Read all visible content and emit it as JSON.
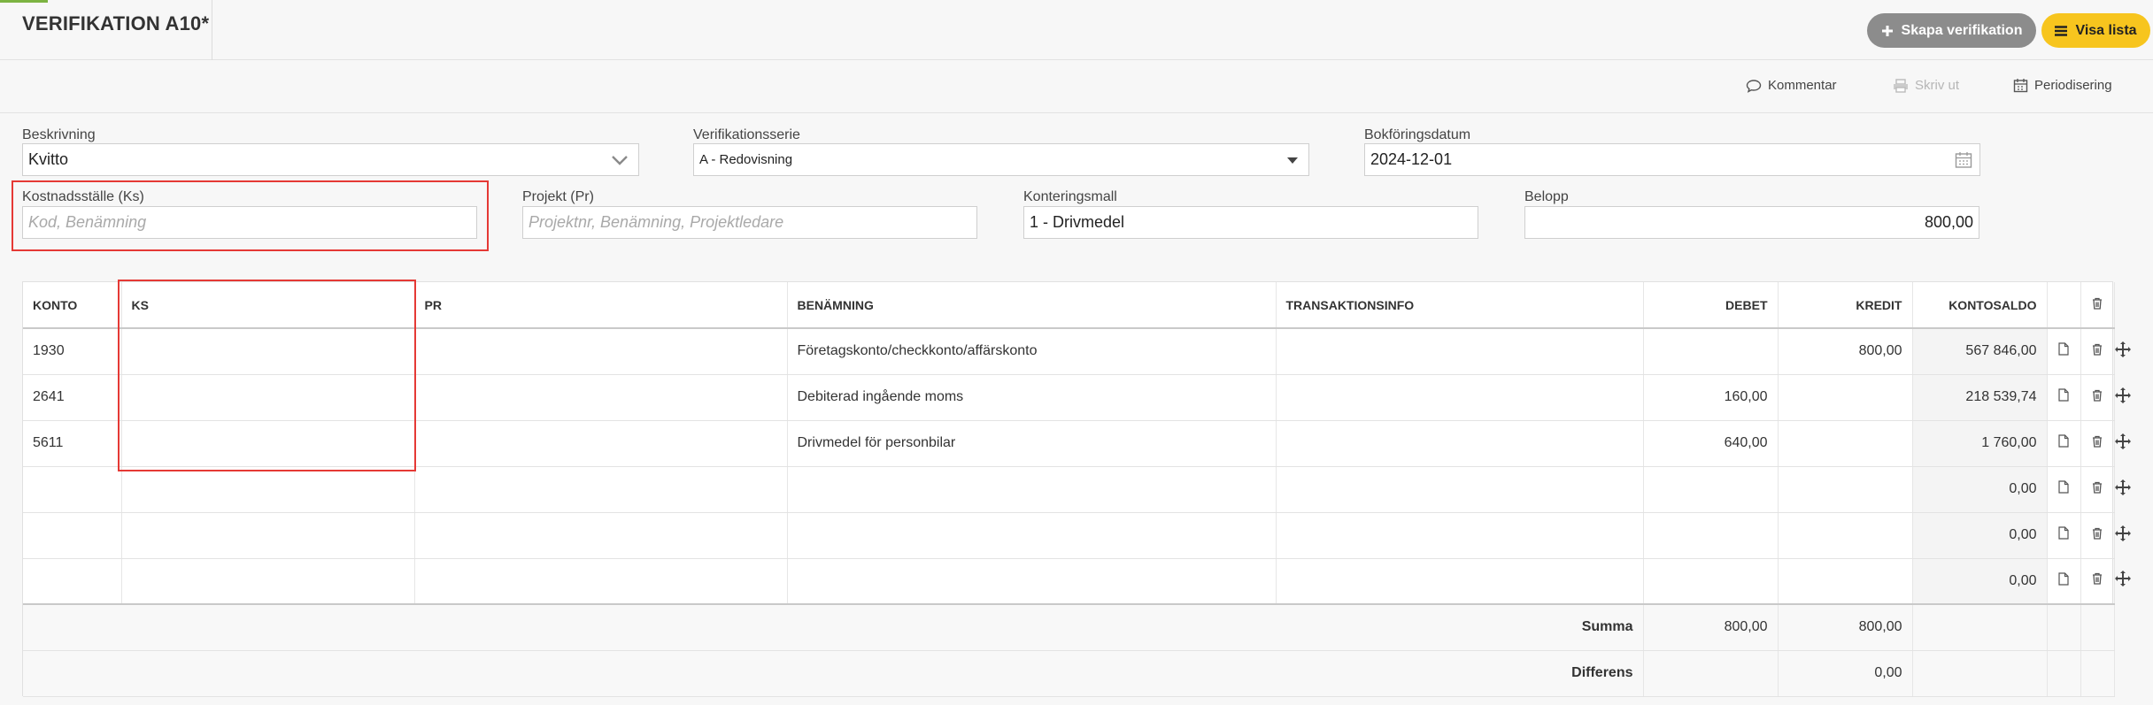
{
  "header": {
    "title": "VERIFIKATION A10*",
    "create_button": "Skapa verifikation",
    "list_button": "Visa lista"
  },
  "actions": {
    "comment": "Kommentar",
    "print": "Skriv ut",
    "accrual": "Periodisering"
  },
  "form": {
    "beskrivning_label": "Beskrivning",
    "beskrivning_value": "Kvitto",
    "serie_label": "Verifikationsserie",
    "serie_value": "A - Redovisning",
    "datum_label": "Bokföringsdatum",
    "datum_value": "2024-12-01",
    "ks_label": "Kostnadsställe (Ks)",
    "ks_placeholder": "Kod, Benämning",
    "projekt_label": "Projekt (Pr)",
    "projekt_placeholder": "Projektnr, Benämning, Projektledare",
    "mall_label": "Konteringsmall",
    "mall_value": "1 - Drivmedel",
    "belopp_label": "Belopp",
    "belopp_value": "800,00"
  },
  "table": {
    "headers": {
      "konto": "KONTO",
      "ks": "KS",
      "pr": "PR",
      "benamning": "BENÄMNING",
      "transaktionsinfo": "TRANSAKTIONSINFO",
      "debet": "DEBET",
      "kredit": "KREDIT",
      "kontosaldo": "KONTOSALDO"
    },
    "rows": [
      {
        "konto": "1930",
        "ks": "",
        "pr": "",
        "benamning": "Företagskonto/checkkonto/affärskonto",
        "info": "",
        "debet": "",
        "kredit": "800,00",
        "saldo": "567 846,00"
      },
      {
        "konto": "2641",
        "ks": "",
        "pr": "",
        "benamning": "Debiterad ingående moms",
        "info": "",
        "debet": "160,00",
        "kredit": "",
        "saldo": "218 539,74"
      },
      {
        "konto": "5611",
        "ks": "",
        "pr": "",
        "benamning": "Drivmedel för personbilar",
        "info": "",
        "debet": "640,00",
        "kredit": "",
        "saldo": "1 760,00"
      },
      {
        "konto": "",
        "ks": "",
        "pr": "",
        "benamning": "",
        "info": "",
        "debet": "",
        "kredit": "",
        "saldo": "0,00"
      },
      {
        "konto": "",
        "ks": "",
        "pr": "",
        "benamning": "",
        "info": "",
        "debet": "",
        "kredit": "",
        "saldo": "0,00"
      },
      {
        "konto": "",
        "ks": "",
        "pr": "",
        "benamning": "",
        "info": "",
        "debet": "",
        "kredit": "",
        "saldo": "0,00"
      }
    ],
    "summa_label": "Summa",
    "summa_debet": "800,00",
    "summa_kredit": "800,00",
    "differens_label": "Differens",
    "differens_value": "0,00"
  }
}
